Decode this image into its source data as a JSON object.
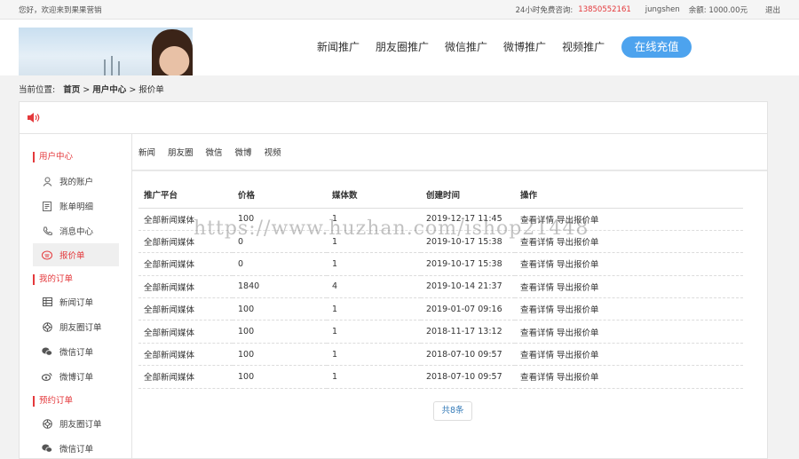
{
  "topbar": {
    "welcome": "您好，欢迎来到果果营销",
    "hotline_label": "24小时免费咨询:",
    "hotline_number": "13850552161",
    "username": "jungshen",
    "balance": "余额: 1000.00元",
    "logout": "退出"
  },
  "nav": {
    "items": [
      "新闻推广",
      "朋友圈推广",
      "微信推广",
      "微博推广",
      "视频推广"
    ],
    "recharge": "在线充值"
  },
  "breadcrumb": {
    "prefix": "当前位置:",
    "home": "首页",
    "sep1": " > ",
    "user_center": "用户中心",
    "sep2": " > ",
    "current": "报价单"
  },
  "sidebar": {
    "group_user": "用户中心",
    "group_orders": "我的订单",
    "group_booking": "预约订单",
    "user_items": [
      "我的账户",
      "账单明细",
      "消息中心",
      "报价单"
    ],
    "order_items": [
      "新闻订单",
      "朋友圈订单",
      "微信订单",
      "微博订单"
    ],
    "booking_items": [
      "朋友圈订单",
      "微信订单"
    ]
  },
  "tabs": [
    "新闻",
    "朋友圈",
    "微信",
    "微博",
    "视频"
  ],
  "table": {
    "headers": [
      "推广平台",
      "价格",
      "媒体数",
      "创建时间",
      "操作"
    ],
    "action_detail": "查看详情",
    "action_export": "导出报价单",
    "rows": [
      [
        "全部新闻媒体",
        "100",
        "1",
        "2019-12-17 11:45"
      ],
      [
        "全部新闻媒体",
        "0",
        "1",
        "2019-10-17 15:38"
      ],
      [
        "全部新闻媒体",
        "0",
        "1",
        "2019-10-17 15:38"
      ],
      [
        "全部新闻媒体",
        "1840",
        "4",
        "2019-10-14 21:37"
      ],
      [
        "全部新闻媒体",
        "100",
        "1",
        "2019-01-07 09:16"
      ],
      [
        "全部新闻媒体",
        "100",
        "1",
        "2018-11-17 13:12"
      ],
      [
        "全部新闻媒体",
        "100",
        "1",
        "2018-07-10 09:57"
      ],
      [
        "全部新闻媒体",
        "100",
        "1",
        "2018-07-10 09:57"
      ]
    ]
  },
  "pager": "共8条",
  "watermark": "https://www.huzhan.com/ishop21448",
  "colors": {
    "accent": "#e4393c",
    "cta": "#4da3ee"
  }
}
